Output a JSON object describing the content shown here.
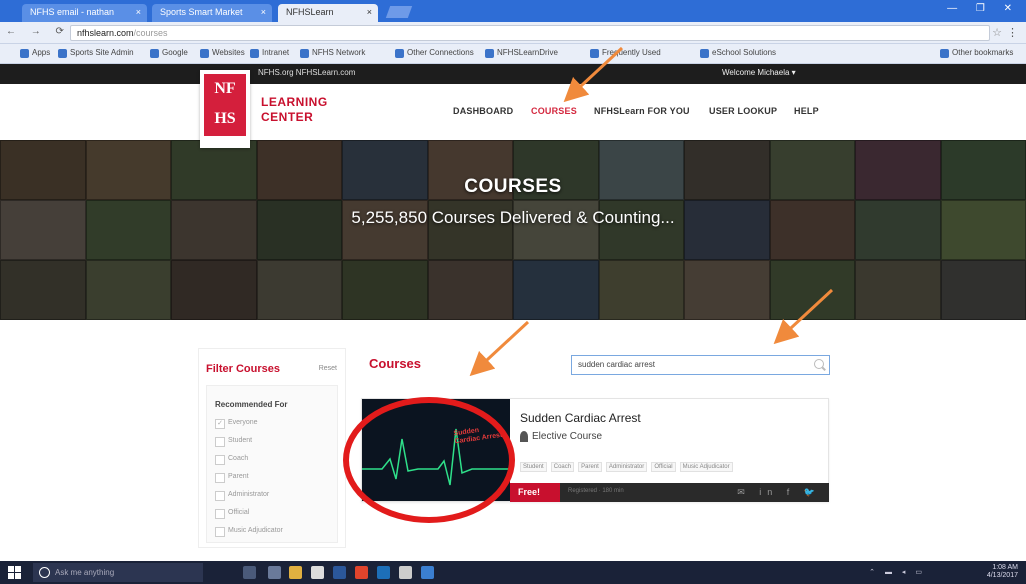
{
  "browser": {
    "tabs": [
      {
        "label": "NFHS email - nathan",
        "close": "×"
      },
      {
        "label": "Sports Smart Market",
        "close": "×"
      },
      {
        "label": "NFHSLearn",
        "close": "×"
      }
    ],
    "window_controls": "— ❐ ✕",
    "nav_buttons": "← → ⟳",
    "url": "nfhslearn.com",
    "url_path": "/courses",
    "star": "☆",
    "menu": "⋮",
    "bookmarks": [
      "Apps",
      "Sports Site Admin",
      "Google",
      "Websites",
      "Intranet",
      "NFHS Network",
      "Other Connections",
      "NFHSLearnDrive",
      "Frequently Used",
      "eSchool Solutions",
      "Other bookmarks"
    ]
  },
  "site": {
    "topbar_links": "NFHS.org  NFHSLearn.com",
    "welcome": "Welcome Michaela ▾",
    "logo_text": "NF HS",
    "brand_line1": "LEARNING",
    "brand_line2": "CENTER",
    "nav": [
      "DASHBOARD",
      "COURSES",
      "NFHSLearn FOR YOU",
      "USER LOOKUP",
      "HELP"
    ]
  },
  "hero": {
    "title": "COURSES",
    "subtitle": "5,255,850 Courses Delivered & Counting..."
  },
  "filter": {
    "title": "Filter Courses",
    "reset": "Reset",
    "section": "Recommended For",
    "options": [
      "Everyone",
      "Student",
      "Coach",
      "Parent",
      "Administrator",
      "Official",
      "Music Adjudicator"
    ]
  },
  "courses": {
    "heading": "Courses",
    "search_value": "sudden cardiac arrest",
    "card": {
      "thumb_text": "Sudden Cardiac Arrest",
      "title": "Sudden Cardiac Arrest",
      "type": "Elective Course",
      "tags": [
        "Student",
        "Coach",
        "Parent",
        "Administrator",
        "Official",
        "Music Adjudicator"
      ],
      "price": "Free!",
      "info": "Registered · 180 min",
      "share_icons": "✉ in f 🐦"
    }
  },
  "taskbar": {
    "search": "Ask me anything",
    "tray_icons": "⌃ ▬ ◂ ▭",
    "time": "1:08 AM",
    "date": "4/13/2017"
  },
  "colors": {
    "accent": "#c8102e",
    "annotation_arrow": "#f08a3c",
    "annotation_circle": "#e21b1b"
  }
}
